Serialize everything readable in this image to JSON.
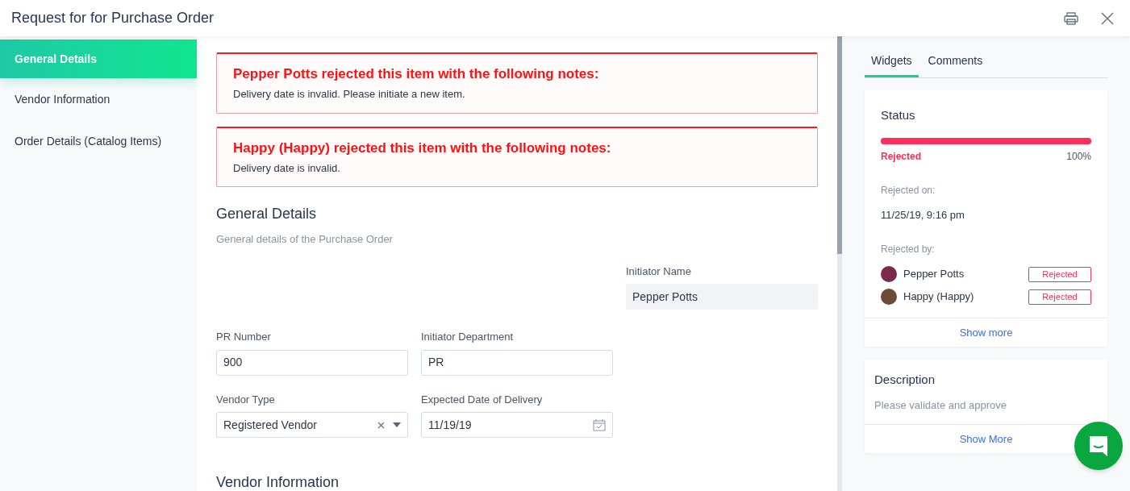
{
  "window": {
    "title": "Request for for Purchase Order"
  },
  "sidebar": {
    "items": [
      {
        "label": "General Details",
        "selected": true
      },
      {
        "label": "Vendor Information",
        "selected": false
      },
      {
        "label": "Order Details (Catalog Items)",
        "selected": false
      }
    ]
  },
  "alerts": [
    {
      "title": "Pepper Potts rejected this item with the following notes:",
      "note": "Delivery date is invalid. Please initiate a new item."
    },
    {
      "title": "Happy (Happy) rejected this item with the following notes:",
      "note": "Delivery date is invalid."
    }
  ],
  "section": {
    "title": "General Details",
    "subtitle": "General details of the Purchase Order"
  },
  "fields": {
    "initiator_name": {
      "label": "Initiator Name",
      "value": "Pepper Potts"
    },
    "pr_number": {
      "label": "PR Number",
      "value": "900"
    },
    "initiator_department": {
      "label": "Initiator Department",
      "value": "PR"
    },
    "vendor_type": {
      "label": "Vendor Type",
      "value": "Registered Vendor"
    },
    "expected_date": {
      "label": "Expected Date of Delivery",
      "value": "11/19/19"
    }
  },
  "next_section": {
    "title": "Vendor Information"
  },
  "tabs": [
    {
      "label": "Widgets",
      "selected": true
    },
    {
      "label": "Comments",
      "selected": false
    }
  ],
  "status": {
    "title": "Status",
    "level": 1,
    "state": "Rejected",
    "percent": "100%",
    "date_label": "Rejected on:",
    "date": "11/25/19, 9:16 pm",
    "by_label": "Rejected by:",
    "people": [
      {
        "name": "Pepper Potts",
        "badge": "Rejected"
      },
      {
        "name": "Happy (Happy)",
        "badge": "Rejected"
      }
    ],
    "link": "Show more"
  },
  "description": {
    "title": "Description",
    "text": "Please validate and approve",
    "link": "Show More"
  }
}
